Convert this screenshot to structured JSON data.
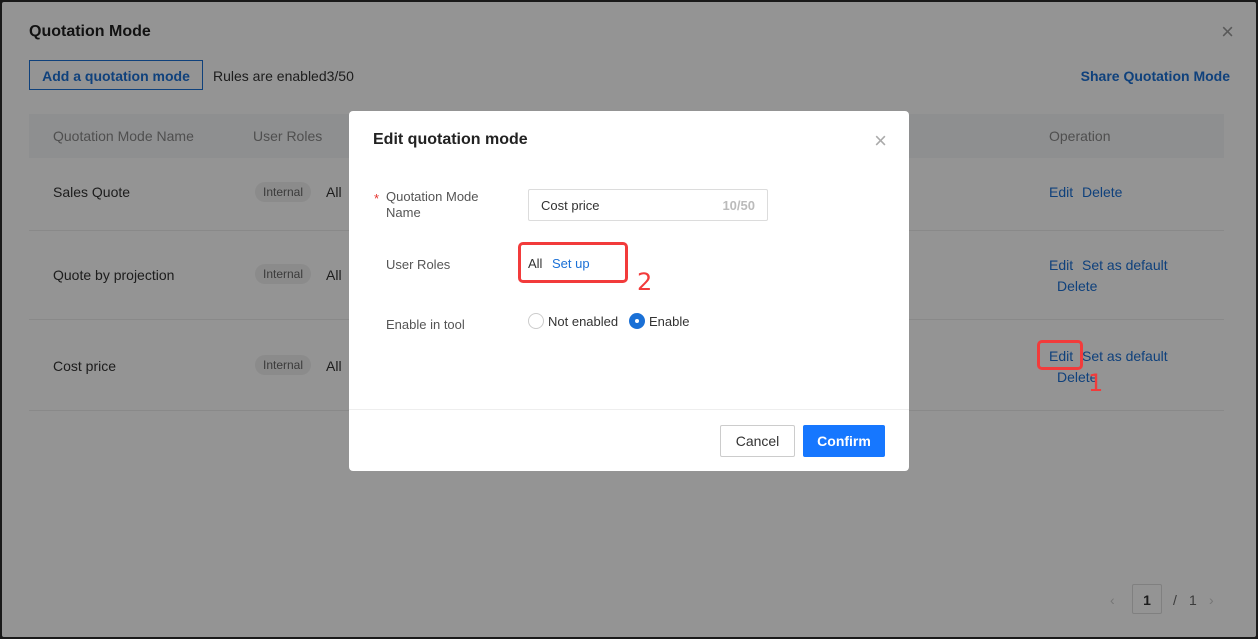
{
  "background": {
    "title": "Quotation Mode",
    "add_button": "Add a quotation mode",
    "rules_text": "Rules are enabled3/50",
    "share_link": "Share Quotation Mode",
    "columns": [
      "Quotation Mode Name",
      "User Roles",
      "Operation"
    ],
    "rows": [
      {
        "name": "Sales Quote",
        "tag": "Internal",
        "role": "All",
        "ops": [
          "Edit",
          "Delete"
        ]
      },
      {
        "name": "Quote by projection",
        "tag": "Internal",
        "role": "All",
        "ops": [
          "Edit",
          "Set as default",
          "Delete"
        ]
      },
      {
        "name": "Cost price",
        "tag": "Internal",
        "role": "All",
        "ops": [
          "Edit",
          "Set as default",
          "Delete"
        ]
      }
    ],
    "pagination": {
      "current": "1",
      "separator": "/",
      "total": "1",
      "prev": "‹",
      "next": "›"
    }
  },
  "modal": {
    "title": "Edit quotation mode",
    "name_label": "Quotation Mode Name",
    "name_required_mark": "*",
    "name_value": "Cost price",
    "name_counter": "10/50",
    "roles_label": "User Roles",
    "roles_value": "All",
    "roles_setup_link": "Set up",
    "enable_label": "Enable in tool",
    "radio_off_label": "Not enabled",
    "radio_on_label": "Enable",
    "cancel_label": "Cancel",
    "confirm_label": "Confirm"
  },
  "annotations": {
    "label_1": "1",
    "label_2": "2"
  },
  "icons": {
    "close": "close-icon"
  }
}
